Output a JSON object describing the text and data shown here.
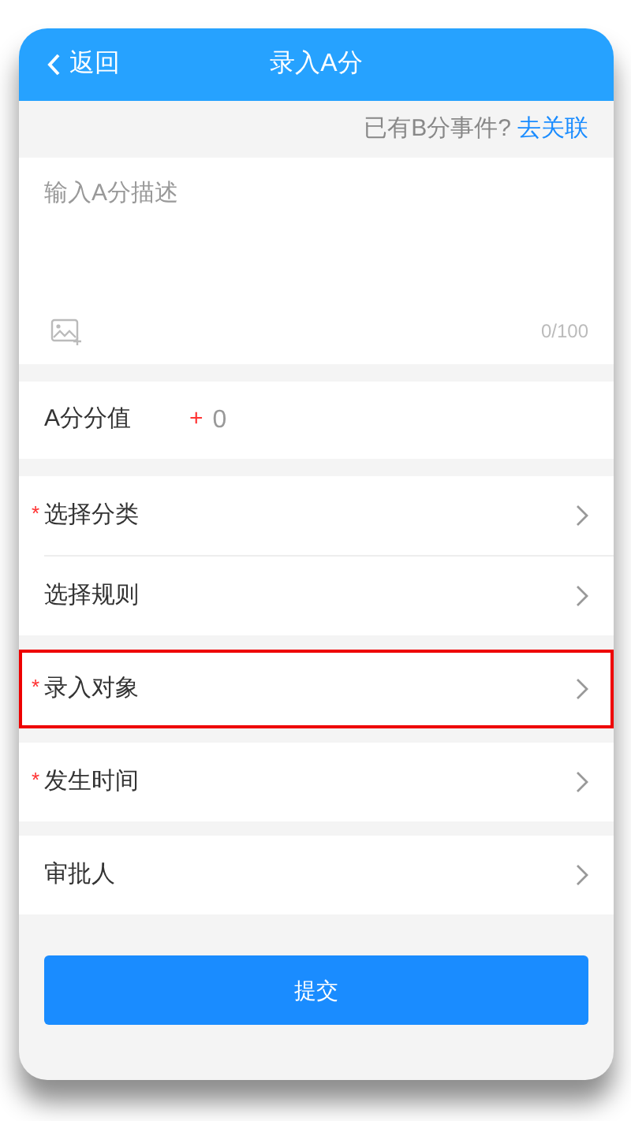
{
  "header": {
    "back_label": "返回",
    "title": "录入A分"
  },
  "link_row": {
    "question": "已有B分事件?",
    "link": "去关联"
  },
  "description": {
    "placeholder": "输入A分描述",
    "counter": "0/100"
  },
  "score": {
    "label": "A分分值",
    "sign": "+",
    "value": "0"
  },
  "groups": [
    {
      "rows": [
        {
          "label": "选择分类",
          "required_mark": "*",
          "highlighted": false
        },
        {
          "label": "选择规则",
          "highlighted": false
        }
      ]
    },
    {
      "rows": [
        {
          "label": "录入对象",
          "required_mark": "*",
          "highlighted": true
        }
      ]
    },
    {
      "rows": [
        {
          "label": "发生时间",
          "required_mark": "*",
          "highlighted": false
        }
      ]
    },
    {
      "rows": [
        {
          "label": "审批人",
          "highlighted": false
        }
      ]
    }
  ],
  "submit_button": "提交"
}
